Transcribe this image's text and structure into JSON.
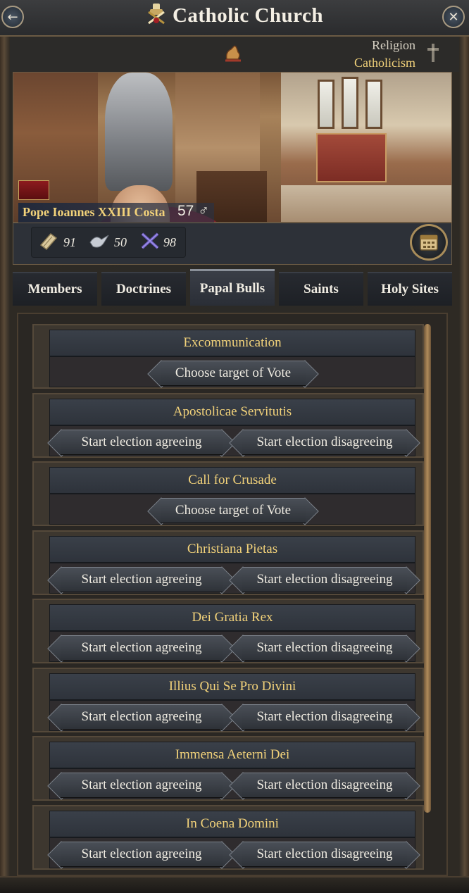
{
  "header": {
    "title": "Catholic Church",
    "back_icon": "arrow-left-icon",
    "close_icon": "close-icon"
  },
  "religion": {
    "label": "Religion",
    "value": "Catholicism"
  },
  "character": {
    "name": "Pope Ioannes XXIII Costa",
    "age": "57",
    "gender_symbol": "♂"
  },
  "stats": [
    {
      "icon": "scroll-icon",
      "value": "91"
    },
    {
      "icon": "dove-icon",
      "value": "50"
    },
    {
      "icon": "crossed-swords-icon",
      "value": "98"
    }
  ],
  "tabs": [
    {
      "label": "Members",
      "active": false
    },
    {
      "label": "Doctrines",
      "active": false
    },
    {
      "label": "Papal Bulls",
      "active": true
    },
    {
      "label": "Saints",
      "active": false
    },
    {
      "label": "Holy Sites",
      "active": false
    }
  ],
  "bulls": [
    {
      "title": "Excommunication",
      "buttons": [
        "Choose target of Vote"
      ]
    },
    {
      "title": "Apostolicae Servitutis",
      "buttons": [
        "Start election agreeing",
        "Start election disagreeing"
      ]
    },
    {
      "title": "Call for Crusade",
      "buttons": [
        "Choose target of Vote"
      ]
    },
    {
      "title": "Christiana Pietas",
      "buttons": [
        "Start election agreeing",
        "Start election disagreeing"
      ]
    },
    {
      "title": "Dei Gratia Rex",
      "buttons": [
        "Start election agreeing",
        "Start election disagreeing"
      ]
    },
    {
      "title": "Illius Qui Se Pro Divini",
      "buttons": [
        "Start election agreeing",
        "Start election disagreeing"
      ]
    },
    {
      "title": "Immensa Aeterni Dei",
      "buttons": [
        "Start election agreeing",
        "Start election disagreeing"
      ]
    },
    {
      "title": "In Coena Domini",
      "buttons": [
        "Start election agreeing",
        "Start election disagreeing"
      ]
    }
  ],
  "colors": {
    "gold_text": "#f2d27a",
    "panel_dark": "#2a2723",
    "button_grey": "#3c4148"
  }
}
